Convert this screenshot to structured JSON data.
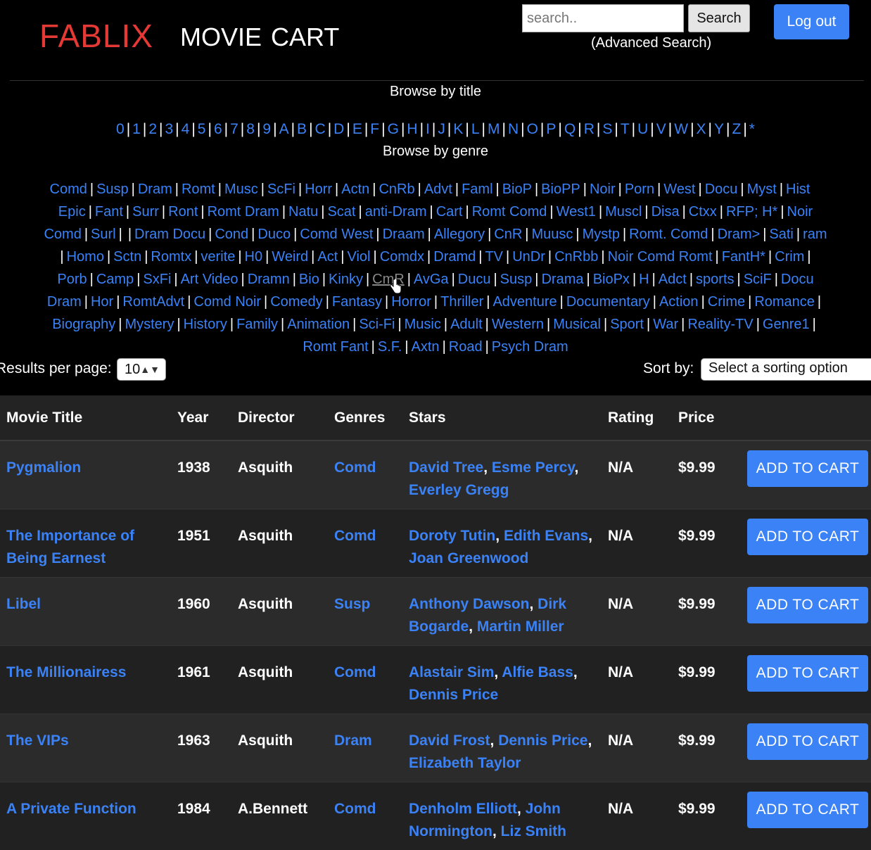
{
  "header": {
    "brand": "FABLIX",
    "nav_movie": "MOVIE",
    "nav_cart": "CART",
    "search_placeholder": "search..",
    "search_button": "Search",
    "advanced_search": "(Advanced Search)",
    "logout": "Log out"
  },
  "browse": {
    "title_heading": "Browse by title",
    "title_links": [
      "0",
      "1",
      "2",
      "3",
      "4",
      "5",
      "6",
      "7",
      "8",
      "9",
      "A",
      "B",
      "C",
      "D",
      "E",
      "F",
      "G",
      "H",
      "I",
      "J",
      "K",
      "L",
      "M",
      "N",
      "O",
      "P",
      "Q",
      "R",
      "S",
      "T",
      "U",
      "V",
      "W",
      "X",
      "Y",
      "Z",
      "*"
    ],
    "genre_heading": "Browse by genre",
    "genre_lines": [
      [
        "Comd",
        "Susp",
        "Dram",
        "Romt",
        "Musc",
        "ScFi",
        "Horr",
        "Actn",
        "CnRb",
        "Advt",
        "Faml",
        "BioP",
        "BioPP",
        "Noir",
        "Porn",
        "West",
        "Docu",
        "Myst",
        "Hist"
      ],
      [
        "Epic",
        "Fant",
        "Surr",
        "Ront",
        "Romt Dram",
        "Natu",
        "Scat",
        "anti-Dram",
        "Cart",
        "Romt Comd",
        "West1",
        "Muscl",
        "Disa",
        "Ctxx",
        "RFP; H*",
        "Noir"
      ],
      [
        "Comd",
        "Surl",
        "",
        "Dram Docu",
        "Cond",
        "Duco",
        "Comd West",
        "Draam",
        "Allegory",
        "CnR",
        "Muusc",
        "Mystp",
        "Romt. Comd",
        "Dram>",
        "Sati",
        "ram"
      ],
      [
        "",
        "Homo",
        "Sctn",
        "Romtx",
        "verite",
        "H0",
        "Weird",
        "Act",
        "Viol",
        "Comdx",
        "Dramd",
        "TV",
        "UnDr",
        "CnRbb",
        "Noir Comd Romt",
        "FantH*",
        "Crim",
        ""
      ],
      [
        "Porb",
        "Camp",
        "SxFi",
        "Art Video",
        "Dramn",
        "Bio",
        "Kinky",
        "CmR",
        "AvGa",
        "Ducu",
        "Susp",
        "Drama",
        "BioPx",
        "H",
        "Adct",
        "sports",
        "SciF",
        "Docu"
      ],
      [
        "Dram",
        "Hor",
        "RomtAdvt",
        "Comd Noir",
        "Comedy",
        "Fantasy",
        "Horror",
        "Thriller",
        "Adventure",
        "Documentary",
        "Action",
        "Crime",
        "Romance",
        ""
      ],
      [
        "Biography",
        "Mystery",
        "History",
        "Family",
        "Animation",
        "Sci-Fi",
        "Music",
        "Adult",
        "Western",
        "Musical",
        "Sport",
        "War",
        "Reality-TV",
        "Genre1",
        ""
      ],
      [
        "Romt Fant",
        "S.F.",
        "Axtn",
        "Road",
        "Psych Dram"
      ]
    ]
  },
  "controls": {
    "results_label": "Results per page:",
    "results_value": "10",
    "sort_label": "Sort by:",
    "sort_value": "Select a sorting option"
  },
  "table": {
    "headers": [
      "Movie Title",
      "Year",
      "Director",
      "Genres",
      "Stars",
      "Rating",
      "Price",
      ""
    ],
    "cart_label": "ADD TO CART",
    "rows": [
      {
        "title": "Pygmalion",
        "year": "1938",
        "director": "Asquith",
        "genre": "Comd",
        "stars": [
          "David Tree",
          "Esme Percy",
          "Everley Gregg"
        ],
        "rating": "N/A",
        "price": "$9.99"
      },
      {
        "title": "The Importance of Being Earnest",
        "year": "1951",
        "director": "Asquith",
        "genre": "Comd",
        "stars": [
          "Doroty Tutin",
          "Edith Evans",
          "Joan Greenwood"
        ],
        "rating": "N/A",
        "price": "$9.99"
      },
      {
        "title": "Libel",
        "year": "1960",
        "director": "Asquith",
        "genre": "Susp",
        "stars": [
          "Anthony Dawson",
          "Dirk Bogarde",
          "Martin Miller"
        ],
        "rating": "N/A",
        "price": "$9.99"
      },
      {
        "title": "The Millionairess",
        "year": "1961",
        "director": "Asquith",
        "genre": "Comd",
        "stars": [
          "Alastair Sim",
          "Alfie Bass",
          "Dennis Price"
        ],
        "rating": "N/A",
        "price": "$9.99"
      },
      {
        "title": "The VIPs",
        "year": "1963",
        "director": "Asquith",
        "genre": "Dram",
        "stars": [
          "David Frost",
          "Dennis Price",
          "Elizabeth Taylor"
        ],
        "rating": "N/A",
        "price": "$9.99"
      },
      {
        "title": "A Private Function",
        "year": "1984",
        "director": "A.Bennett",
        "genre": "Comd",
        "stars": [
          "Denholm Elliott",
          "John Normington",
          "Liz Smith"
        ],
        "rating": "N/A",
        "price": "$9.99"
      }
    ]
  }
}
